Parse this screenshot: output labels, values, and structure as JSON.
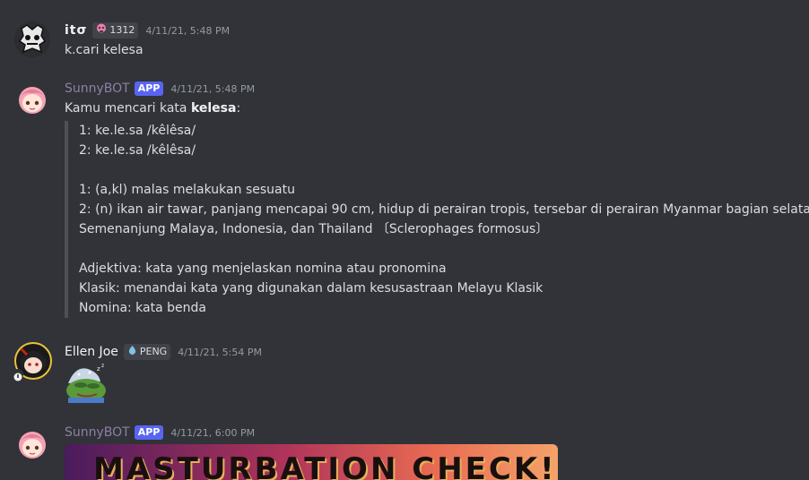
{
  "messages": [
    {
      "username": "itσ",
      "tag_text": "1312",
      "timestamp": "4/11/21, 5:48 PM",
      "content": "k.cari kelesa",
      "colors": {
        "username": "#f2f3f5",
        "tag_icon": "#f47fae"
      }
    },
    {
      "username": "SunnyBOT",
      "badge": "APP",
      "timestamp": "4/11/21, 5:48 PM",
      "intro_prefix": "Kamu mencari kata ",
      "intro_bold": "kelesa",
      "intro_suffix": ":",
      "quote_lines": [
        "1: ke.le.sa /kêlêsa/",
        "2: ke.le.sa /kêlêsa/",
        "",
        "1: (a,kl) malas melakukan sesuatu",
        "2: (n) ikan air tawar, panjang mencapai 90 cm, hidup di perairan tropis, tersebar di perairan Myanmar bagian selatan,",
        "Semenanjung Malaya, Indonesia, dan Thailand 〔Sclerophages formosus〕",
        "",
        "Adjektiva: kata yang menjelaskan nomina atau pronomina",
        "Klasik: menandai kata yang digunakan dalam kesusastraan Melayu Klasik",
        "Nomina: kata benda"
      ],
      "colors": {
        "username": "#8e7fa6",
        "badge": "#5865f2"
      }
    },
    {
      "username": "Ellen Joe",
      "tag_text": "PENG",
      "timestamp": "4/11/21, 5:54 PM",
      "sticker": "sleeping-pepe-sticker",
      "colors": {
        "username": "#f2f3f5",
        "tag_icon": "#7ec3e8"
      }
    },
    {
      "username": "SunnyBOT",
      "badge": "APP",
      "timestamp": "4/11/21, 6:00 PM",
      "image_caption": "MASTURBATION CHECK!",
      "colors": {
        "username": "#8e7fa6",
        "badge": "#5865f2"
      }
    }
  ],
  "icons": {
    "tag1": "pink-skull-icon",
    "tag3": "water-drop-icon",
    "status": "idle-moon-icon"
  }
}
